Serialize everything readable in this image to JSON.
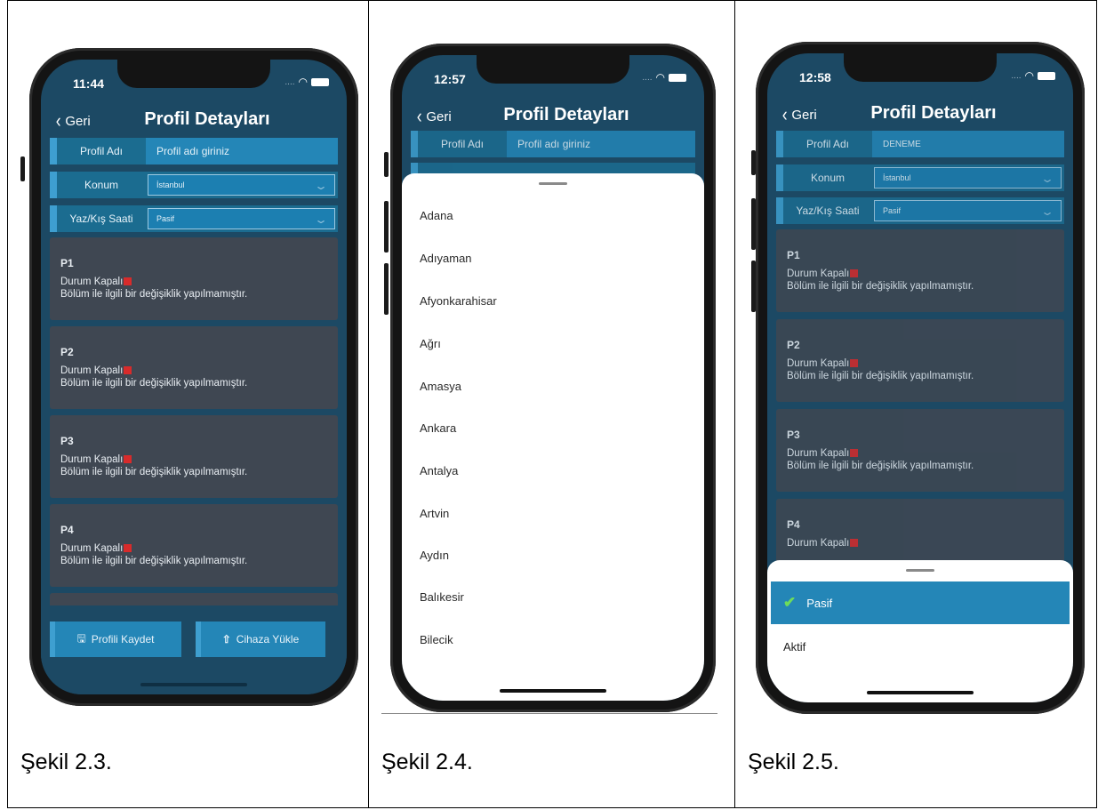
{
  "captions": [
    "Şekil 2.3.",
    "Şekil 2.4.",
    "Şekil 2.5."
  ],
  "phone1": {
    "time": "11:44",
    "back": "Geri",
    "title": "Profil Detayları",
    "fields": {
      "profile_label": "Profil Adı",
      "profile_value": "Profil adı giriniz",
      "location_label": "Konum",
      "location_value": "İstanbul",
      "dst_label": "Yaz/Kış Saati",
      "dst_value": "Pasif"
    },
    "cards": [
      {
        "name": "P1",
        "status": "Durum Kapalı",
        "desc": "Bölüm ile ilgili bir değişiklik yapılmamıştır."
      },
      {
        "name": "P2",
        "status": "Durum Kapalı",
        "desc": "Bölüm ile ilgili bir değişiklik yapılmamıştır."
      },
      {
        "name": "P3",
        "status": "Durum Kapalı",
        "desc": "Bölüm ile ilgili bir değişiklik yapılmamıştır."
      },
      {
        "name": "P4",
        "status": "Durum Kapalı",
        "desc": "Bölüm ile ilgili bir değişiklik yapılmamıştır."
      }
    ],
    "save_button": "Profili Kaydet",
    "upload_button": "Cihaza Yükle"
  },
  "phone2": {
    "time": "12:57",
    "back": "Geri",
    "title": "Profil Detayları",
    "fields": {
      "profile_label": "Profil Adı",
      "profile_value": "Profil adı giriniz"
    },
    "cities": [
      "Adana",
      "Adıyaman",
      "Afyonkarahisar",
      "Ağrı",
      "Amasya",
      "Ankara",
      "Antalya",
      "Artvin",
      "Aydın",
      "Balıkesir",
      "Bilecik"
    ]
  },
  "phone3": {
    "time": "12:58",
    "back": "Geri",
    "title": "Profil Detayları",
    "fields": {
      "profile_label": "Profil Adı",
      "profile_value": "DENEME",
      "location_label": "Konum",
      "location_value": "İstanbul",
      "dst_label": "Yaz/Kış Saati",
      "dst_value": "Pasif"
    },
    "cards": [
      {
        "name": "P1",
        "status": "Durum Kapalı",
        "desc": "Bölüm ile ilgili bir değişiklik yapılmamıştır."
      },
      {
        "name": "P2",
        "status": "Durum Kapalı",
        "desc": "Bölüm ile ilgili bir değişiklik yapılmamıştır."
      },
      {
        "name": "P3",
        "status": "Durum Kapalı",
        "desc": "Bölüm ile ilgili bir değişiklik yapılmamıştır."
      },
      {
        "name": "P4",
        "status": "Durum Kapalı"
      }
    ],
    "options": [
      "Pasif",
      "Aktif"
    ],
    "selected_option": "Pasif"
  },
  "colors": {
    "app_bg": "#1c4964",
    "field": "#2486b7",
    "accent": "#3e9fd0",
    "card": "#3f4752",
    "status_off": "#d72b2b",
    "check": "#6ddc5b"
  }
}
